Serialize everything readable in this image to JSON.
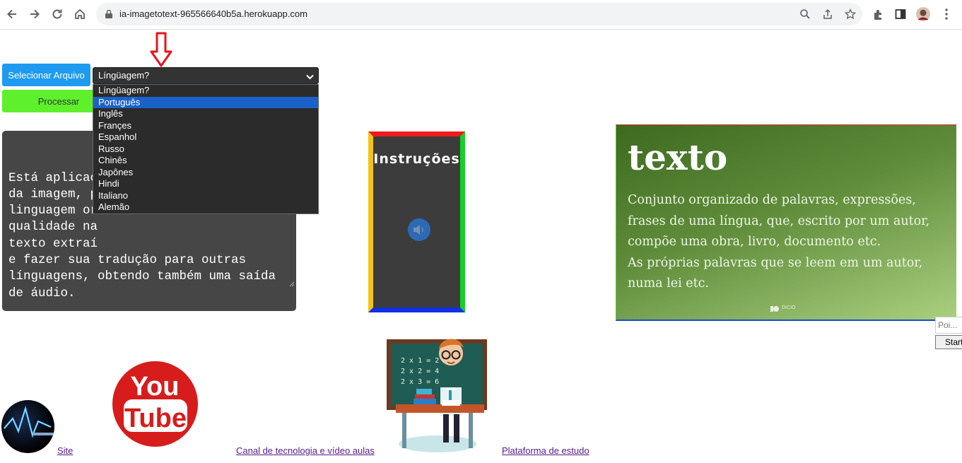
{
  "browser": {
    "url": "ia-imagetotext-965566640b5a.herokuapp.com"
  },
  "toolbar": {
    "select_file_label": "Selecionar Arquivo",
    "process_label": "Processar"
  },
  "language_select": {
    "selected_value": "Língüagem?",
    "options": [
      "Língüagem?",
      "Português",
      "Inglês",
      "Françes",
      "Espanhol",
      "Russo",
      "Chinês",
      "Japônes",
      "Hindi",
      "Italiano",
      "Alemão"
    ],
    "highlighted_option": "Português"
  },
  "textarea": {
    "lines": [
      "Está aplicac",
      "da imagem, p",
      "linguagem or",
      "qualidade na",
      "texto extraí",
      "e fazer sua tradução para outras",
      "línguagens, obtendo também uma saída",
      "de áudio."
    ]
  },
  "instructions": {
    "title": "Instruções"
  },
  "card": {
    "title": "texto",
    "definition_lines": [
      "Conjunto organizado de palavras, expressões,",
      "frases de uma língua, que, escrito por um autor,",
      "compõe uma obra, livro, documento etc.",
      "As próprias palavras que se leem em um autor,",
      "numa lei etc."
    ],
    "logo_text": "DICIO"
  },
  "side_widget": {
    "input_placeholder": "Poi...",
    "button_label": "Start"
  },
  "youtube_logo": {
    "line1": "You",
    "line2": "Tube"
  },
  "blackboard": {
    "lines": [
      "2 x 1 = 2",
      "2 x 2 = 4",
      "2 x 3 = 6"
    ]
  },
  "footer": {
    "site_link": "Site",
    "channel_link": "Canal de tecnologia e vídeo aulas",
    "platform_link": "Plataforma de estudo"
  },
  "colors": {
    "select_button": "#1e9bf0",
    "process_button": "#5ef02c",
    "arrow": "#e8141b"
  }
}
